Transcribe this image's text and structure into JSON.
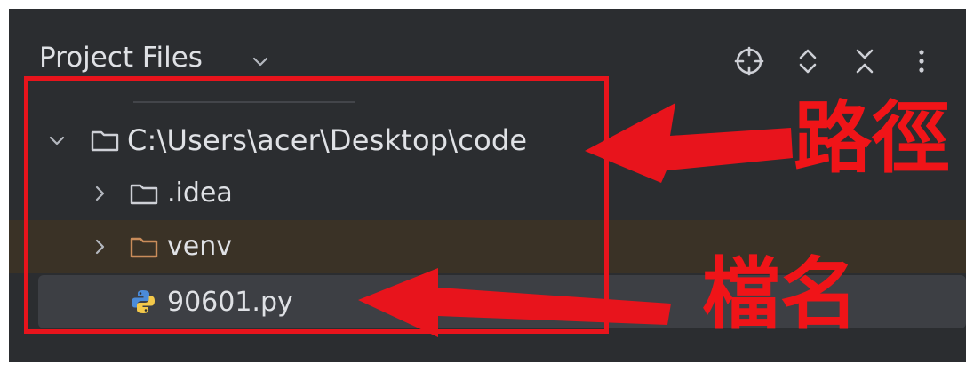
{
  "header": {
    "title": "Project Files",
    "title_icon": "chevron-down-icon",
    "actions": [
      {
        "name": "locate-icon"
      },
      {
        "name": "expand-all-icon"
      },
      {
        "name": "collapse-all-icon"
      },
      {
        "name": "more-options-icon"
      }
    ]
  },
  "tree": {
    "root_label": "C:\\Users\\acer\\Desktop\\code",
    "items": [
      {
        "label": ".idea",
        "icon": "folder-icon"
      },
      {
        "label": "venv",
        "icon": "folder-icon"
      },
      {
        "label": "90601.py",
        "icon": "python-file-icon"
      }
    ]
  },
  "annotations": {
    "path_label": "路徑",
    "filename_label": "檔名"
  },
  "colors": {
    "panel_bg": "#2b2d30",
    "selected_row": "#3d3f44",
    "venv_row": "#3a3226",
    "text": "#dfe1e5",
    "annotation_red": "#e8141c",
    "venv_folder": "#c98c5a"
  }
}
